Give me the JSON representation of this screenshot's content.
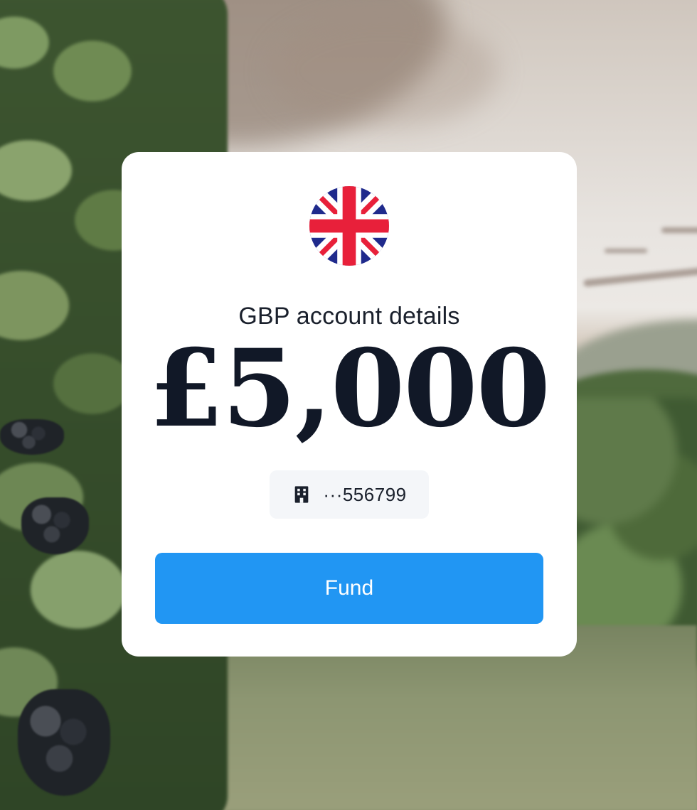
{
  "card": {
    "flag": "united-kingdom-flag",
    "title": "GBP account details",
    "amount": "£5,000",
    "account": {
      "icon": "bank-building-icon",
      "masked_number": "···556799"
    },
    "fund_button": {
      "label": "Fund",
      "color": "#2196f3"
    }
  },
  "colors": {
    "card_bg": "#ffffff",
    "text": "#111827",
    "accent": "#2196f3"
  }
}
